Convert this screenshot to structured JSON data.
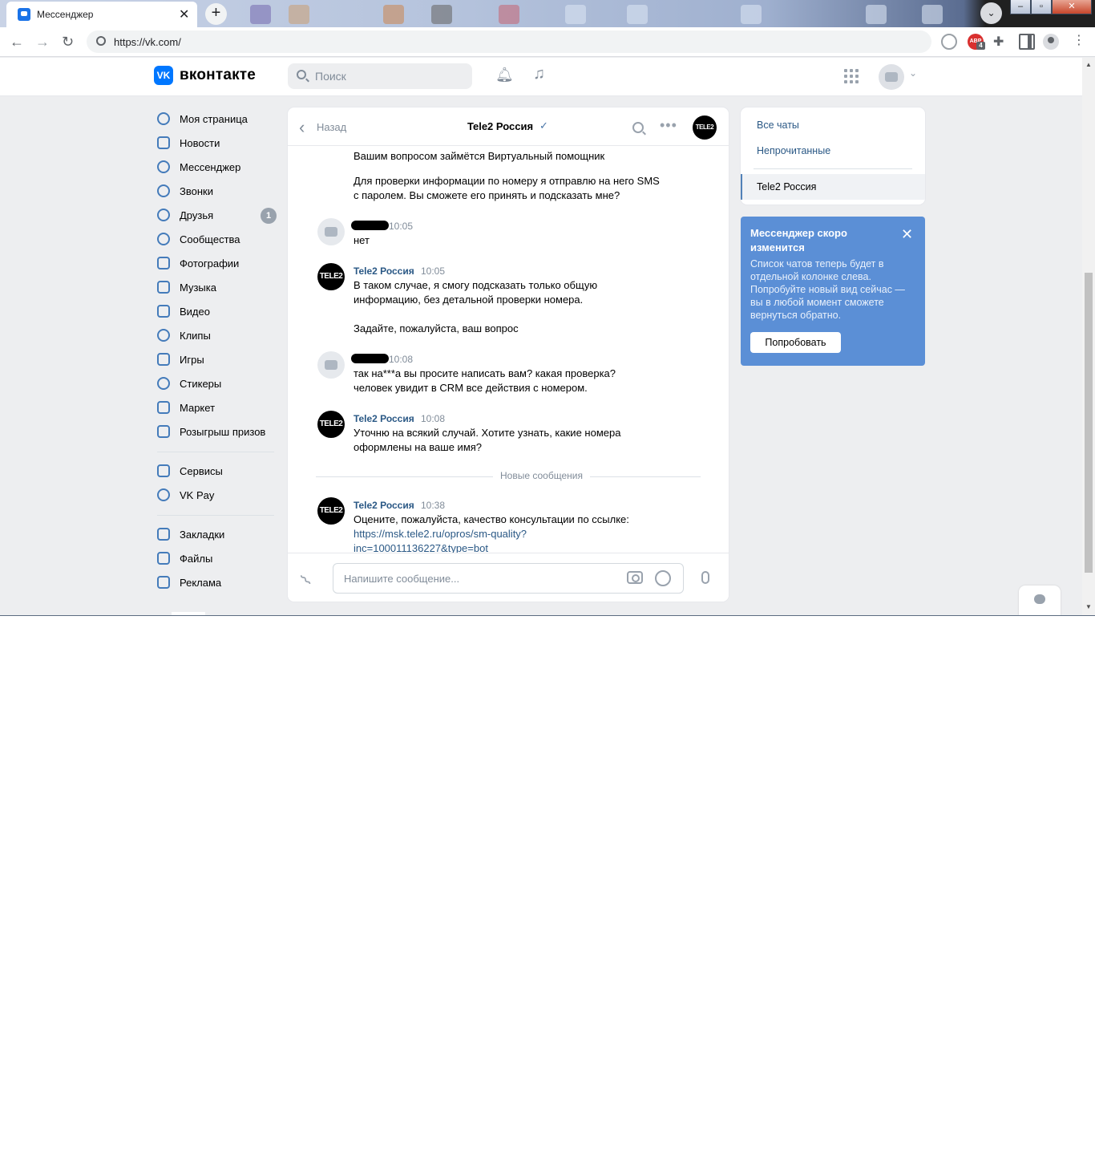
{
  "browser": {
    "tab_title": "Мессенджер",
    "tab_close": "✕",
    "new_tab": "+",
    "url": "https://vk.com/",
    "abp_label": "ABP",
    "abp_count": "4",
    "win_minimize": "–",
    "win_restore": "▫",
    "win_close": "✕"
  },
  "header": {
    "logo_mark": "VK",
    "logo_text": "вконтакте",
    "search_placeholder": "Поиск"
  },
  "sidebar": {
    "items": [
      {
        "label": "Моя страница",
        "icon": "user-circle-icon"
      },
      {
        "label": "Новости",
        "icon": "news-icon"
      },
      {
        "label": "Мессенджер",
        "icon": "message-icon"
      },
      {
        "label": "Звонки",
        "icon": "phone-icon"
      },
      {
        "label": "Друзья",
        "icon": "friends-icon",
        "badge": "1"
      },
      {
        "label": "Сообщества",
        "icon": "groups-icon"
      },
      {
        "label": "Фотографии",
        "icon": "photo-icon"
      },
      {
        "label": "Музыка",
        "icon": "music-icon"
      },
      {
        "label": "Видео",
        "icon": "video-icon"
      },
      {
        "label": "Клипы",
        "icon": "clips-icon"
      },
      {
        "label": "Игры",
        "icon": "gamepad-icon"
      },
      {
        "label": "Стикеры",
        "icon": "sticker-icon"
      },
      {
        "label": "Маркет",
        "icon": "market-icon"
      },
      {
        "label": "Розыгрыш призов",
        "icon": "gift-icon"
      }
    ],
    "group2": [
      {
        "label": "Сервисы",
        "icon": "services-icon"
      },
      {
        "label": "VK Pay",
        "icon": "vkpay-icon"
      }
    ],
    "group3": [
      {
        "label": "Закладки",
        "icon": "bookmark-icon"
      },
      {
        "label": "Файлы",
        "icon": "file-icon"
      },
      {
        "label": "Реклама",
        "icon": "megaphone-icon"
      }
    ]
  },
  "chat": {
    "back_label": "Назад",
    "title": "Tele2 Россия",
    "verified": "✓",
    "more": "•••",
    "avatar_text": "TELE2",
    "messages": {
      "m0_line1": "Вашим вопросом займётся Виртуальный помощник",
      "m0_line2": "Для проверки информации по номеру я отправлю на него SMS",
      "m0_line3": "с паролем. Вы сможете его принять и подсказать мне?",
      "m1_time": "10:05",
      "m1_text": "нет",
      "m2_author": "Tele2 Россия",
      "m2_time": "10:05",
      "m2_line1": "В таком случае, я смогу подсказать только общую",
      "m2_line2": "информацию, без детальной проверки номера.",
      "m2_line3": "Задайте, пожалуйста, ваш вопрос",
      "m3_time": "10:08",
      "m3_line1": "так на***а вы просите написать вам? какая проверка?",
      "m3_line2": "человек увидит в CRM все действия с номером.",
      "m4_author": "Tele2 Россия",
      "m4_time": "10:08",
      "m4_line1": "Уточню на всякий случай. Хотите узнать, какие номера",
      "m4_line2": "оформлены на ваше имя?",
      "divider": "Новые сообщения",
      "m5_author": "Tele2 Россия",
      "m5_time": "10:38",
      "m5_line1": "Оцените, пожалуйста, качество консультации по ссылке:",
      "m5_link1": "https://msk.tele2.ru/opros/sm-quality?",
      "m5_link2": "inc=100011136227&type=bot"
    },
    "input_placeholder": "Напишите сообщение..."
  },
  "right_panel": {
    "all_chats": "Все чаты",
    "unread": "Непрочитанные",
    "active_chat": "Tele2 Россия"
  },
  "promo": {
    "title": "Мессенджер скоро изменится",
    "close": "✕",
    "text": "Список чатов теперь будет в отдельной колонке слева. Попробуйте новый вид сейчас — вы в любой момент сможете вернуться обратно.",
    "button": "Попробовать"
  }
}
